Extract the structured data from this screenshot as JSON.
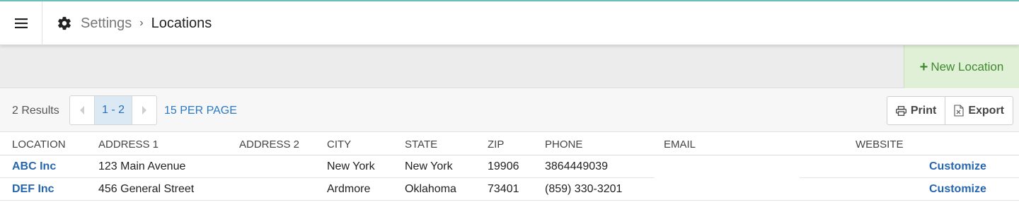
{
  "header": {
    "breadcrumb": {
      "parent": "Settings",
      "separator": "›",
      "current": "Locations"
    },
    "icons": {
      "menu": "hamburger-icon",
      "settings": "gear-icon"
    }
  },
  "actions": {
    "new_location": "New Location",
    "new_location_icon": "+"
  },
  "toolbar": {
    "results": "2 Results",
    "page_range": "1 - 2",
    "per_page": "15 PER PAGE",
    "print": "Print",
    "export": "Export"
  },
  "table": {
    "columns": [
      "LOCATION",
      "ADDRESS 1",
      "ADDRESS 2",
      "CITY",
      "STATE",
      "ZIP",
      "PHONE",
      "EMAIL",
      "WEBSITE"
    ],
    "rows": [
      {
        "location": "ABC Inc",
        "address1": "123 Main Avenue",
        "address2": "",
        "city": "New York",
        "state": "New York",
        "zip": "19906",
        "phone": "3864449039",
        "email": "",
        "website": "",
        "action": "Customize"
      },
      {
        "location": "DEF Inc",
        "address1": "456 General Street",
        "address2": "",
        "city": "Ardmore",
        "state": "Oklahoma",
        "zip": "73401",
        "phone": "(859) 330-3201",
        "email": "",
        "website": "",
        "action": "Customize"
      }
    ]
  },
  "colors": {
    "accent_link": "#2566ae",
    "new_button_bg": "#dff0d6",
    "new_button_text": "#3f8a2e",
    "page_active_bg": "#dbe9f5"
  }
}
